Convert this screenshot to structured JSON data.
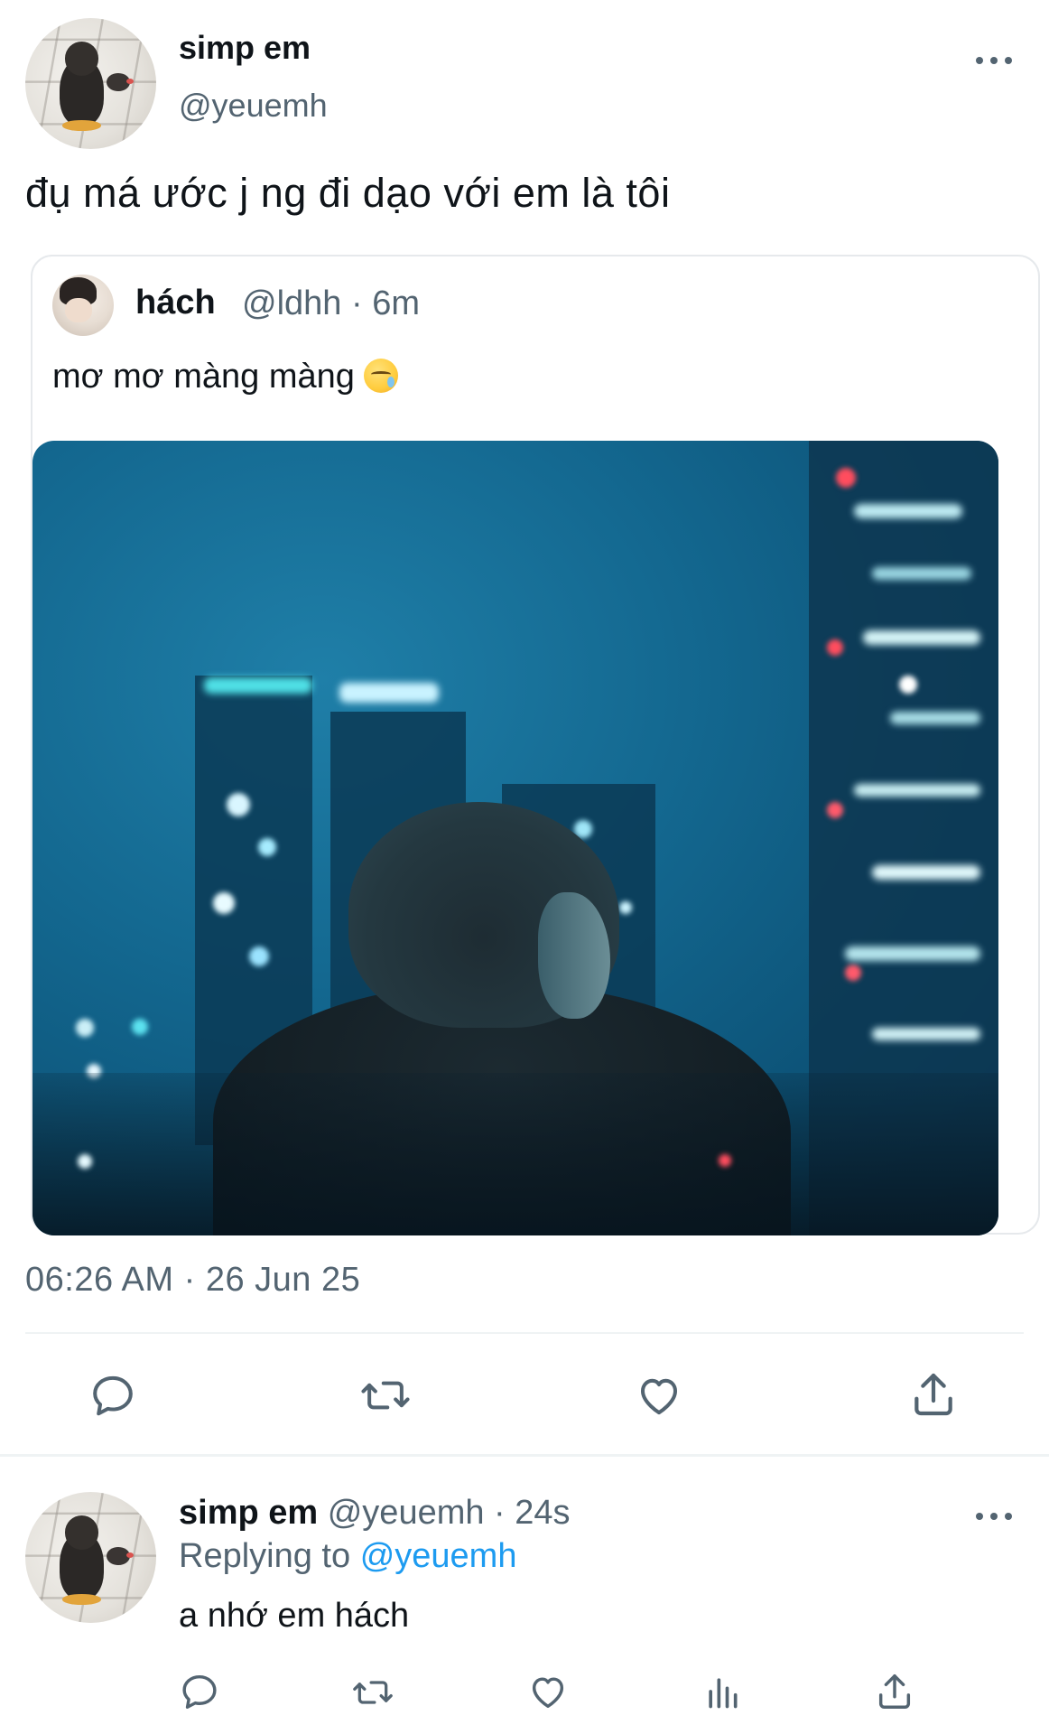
{
  "main_tweet": {
    "display_name": "simp em",
    "handle": "@yeuemh",
    "text": "đụ má ước j ng đi dạo với em là tôi",
    "timestamp": "06:26 AM · 26 Jun 25",
    "more_icon": "more-horizontal-icon"
  },
  "quoted_tweet": {
    "display_name": "hách",
    "meta": "@ldhh · 6m",
    "text": "mơ mơ màng màng",
    "emoji": "sleepy-face-emoji",
    "media_description_icon": "photo-city-night"
  },
  "main_actions": [
    {
      "icon": "reply-icon"
    },
    {
      "icon": "retweet-icon"
    },
    {
      "icon": "like-icon"
    },
    {
      "icon": "share-icon"
    }
  ],
  "reply_tweet": {
    "display_name": "simp em",
    "meta": "@yeuemh · 24s",
    "replying_prefix": "Replying to",
    "replying_to": "@yeuemh",
    "text": "a nhớ em hách",
    "more_icon": "more-horizontal-icon"
  },
  "reply_actions": [
    {
      "icon": "reply-icon"
    },
    {
      "icon": "retweet-icon"
    },
    {
      "icon": "like-icon"
    },
    {
      "icon": "analytics-icon"
    },
    {
      "icon": "share-icon"
    }
  ],
  "colors": {
    "text_primary": "#0f1419",
    "text_secondary": "#536471",
    "link": "#1d9bf0",
    "divider": "#eff3f4"
  }
}
